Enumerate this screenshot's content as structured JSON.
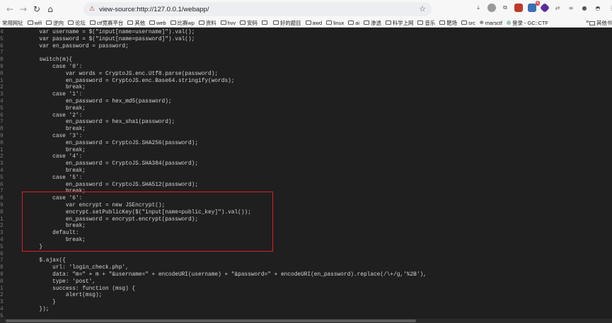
{
  "browser": {
    "url": "view-source:http://127.0.0.1/webapp/",
    "bookmarks": [
      "常用网址",
      "wifi",
      "逆向",
      "论坛",
      "ctf竞赛平台",
      "其他",
      "web",
      "比赛wp",
      "资料",
      "hvv",
      "安码",
      "",
      "好的题目",
      "awd",
      "linux",
      "ai",
      "渗透",
      "科学上网",
      "音乐",
      "靶场",
      "src",
      "marsctf",
      "登录 - GC::CTF"
    ],
    "other_bookmarks": "其他书",
    "extension_badge": "6"
  },
  "source": {
    "lines": [
      {
        "n": "4",
        "code": "        var username = $(\"input[name=username]\").val();"
      },
      {
        "n": "5",
        "code": "        var password = $(\"input[name=password]\").val();"
      },
      {
        "n": "6",
        "code": "        var en_password = password;"
      },
      {
        "n": "7",
        "code": ""
      },
      {
        "n": "8",
        "code": "        switch(m){"
      },
      {
        "n": "9",
        "code": "            case '0':"
      },
      {
        "n": "0",
        "code": "                var words = CryptoJS.enc.Utf8.parse(password);"
      },
      {
        "n": "1",
        "code": "                en_password = CryptoJS.enc.Base64.stringify(words);"
      },
      {
        "n": "2",
        "code": "                break;"
      },
      {
        "n": "3",
        "code": "            case '1':"
      },
      {
        "n": "4",
        "code": "                en_password = hex_md5(password);"
      },
      {
        "n": "5",
        "code": "                break;"
      },
      {
        "n": "6",
        "code": "            case '2':"
      },
      {
        "n": "7",
        "code": "                en_password = hex_sha1(password);"
      },
      {
        "n": "8",
        "code": "                break;"
      },
      {
        "n": "9",
        "code": "            case '3':"
      },
      {
        "n": "0",
        "code": "                en_password = CryptoJS.SHA256(password);"
      },
      {
        "n": "1",
        "code": "                break;"
      },
      {
        "n": "2",
        "code": "            case '4':"
      },
      {
        "n": "3",
        "code": "                en_password = CryptoJS.SHA384(password);"
      },
      {
        "n": "4",
        "code": "                break;"
      },
      {
        "n": "5",
        "code": "            case '5':"
      },
      {
        "n": "6",
        "code": "                en_password = CryptoJS.SHA512(password);"
      },
      {
        "n": "7",
        "code": "                break;"
      },
      {
        "n": "8",
        "code": "            case '6':"
      },
      {
        "n": "9",
        "code": "                var encrypt = new JSEncrypt();"
      },
      {
        "n": "0",
        "code": "                encrypt.setPublicKey($(\"input[name=public_key]\").val());"
      },
      {
        "n": "1",
        "code": "                en_password = encrypt.encrypt(password);"
      },
      {
        "n": "2",
        "code": "                break;"
      },
      {
        "n": "3",
        "code": "            default:"
      },
      {
        "n": "4",
        "code": "                break;"
      },
      {
        "n": "5",
        "code": "        }"
      },
      {
        "n": "6",
        "code": ""
      },
      {
        "n": "7",
        "code": "        $.ajax({"
      },
      {
        "n": "8",
        "code": "            url: 'login_check.php',"
      },
      {
        "n": "9",
        "code": "            data: \"m=\" + m + \"&username=\" + encodeURI(username) + \"&password=\" + encodeURI(en_password).replace(/\\+/g,'%2B'),"
      },
      {
        "n": "0",
        "code": "            type: 'post',"
      },
      {
        "n": "1",
        "code": "            success: function (msg) {"
      },
      {
        "n": "2",
        "code": "                alert(msg);"
      },
      {
        "n": "3",
        "code": "            }"
      },
      {
        "n": "4",
        "code": "        });"
      },
      {
        "n": "5",
        "code": ""
      },
      {
        "n": "6",
        "code": "    });"
      }
    ]
  },
  "colors": {
    "highlight_border": "#e11d21",
    "source_background": "#1f1f1f"
  }
}
